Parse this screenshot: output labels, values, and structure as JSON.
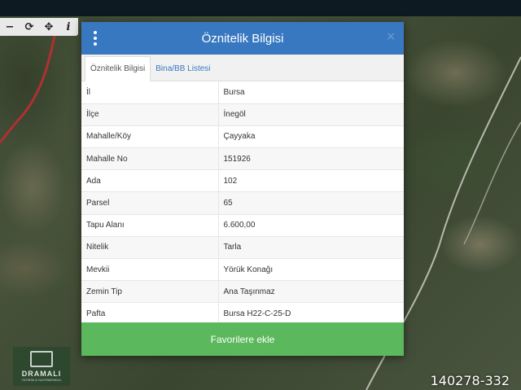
{
  "toolbar": {
    "icons": [
      "minus-icon",
      "refresh-icon",
      "move-icon",
      "info-icon"
    ],
    "minus": "−",
    "refresh": "⟳",
    "move": "✥",
    "info": "i"
  },
  "dialog": {
    "title": "Öznitelik Bilgisi",
    "close": "×",
    "tabs": [
      {
        "label": "Öznitelik Bilgisi",
        "active": true
      },
      {
        "label": "Bina/BB Listesi",
        "active": false
      }
    ],
    "rows": [
      {
        "key": "İl",
        "value": "Bursa"
      },
      {
        "key": "İlçe",
        "value": "İnegöl"
      },
      {
        "key": "Mahalle/Köy",
        "value": "Çayyaka"
      },
      {
        "key": "Mahalle No",
        "value": "151926"
      },
      {
        "key": "Ada",
        "value": "102"
      },
      {
        "key": "Parsel",
        "value": "65"
      },
      {
        "key": "Tapu Alanı",
        "value": "6.600,00"
      },
      {
        "key": "Nitelik",
        "value": "Tarla"
      },
      {
        "key": "Mevkii",
        "value": "Yörük Konağı"
      },
      {
        "key": "Zemin Tip",
        "value": "Ana Taşınmaz"
      },
      {
        "key": "Pafta",
        "value": "Bursa H22-C-25-D"
      }
    ],
    "favorite_button": "Favorilere ekle"
  },
  "watermark": {
    "logo_text": "DRAMALI",
    "logo_sub": "YATIRIM & GAYRİMENKUL"
  },
  "listing_id": "140278-332",
  "colors": {
    "header": "#3878c0",
    "favorite": "#5cb85c",
    "top_bar": "#0d1a22"
  }
}
